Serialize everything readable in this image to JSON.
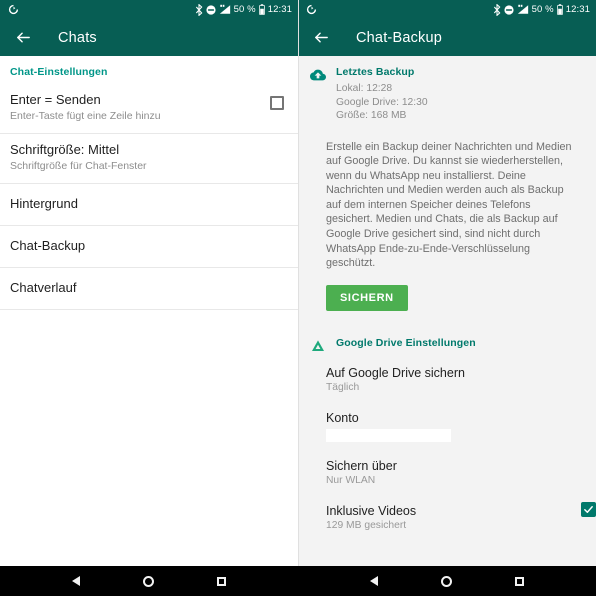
{
  "status_bar": {
    "left_icon": "sync-circle-icon",
    "icons": [
      "bluetooth-icon",
      "do-not-disturb-icon",
      "signal-bars-icon",
      "battery-icon"
    ],
    "battery_percent": "50 %",
    "time": "12:31"
  },
  "left_pane": {
    "appbar": {
      "back_icon": "arrow-back-icon",
      "title": "Chats"
    },
    "section_header": "Chat-Einstellungen",
    "rows": [
      {
        "title": "Enter = Senden",
        "subtitle": "Enter-Taste fügt eine Zeile hinzu",
        "control": "checkbox",
        "checked": false
      },
      {
        "title": "Schriftgröße: Mittel",
        "subtitle": "Schriftgröße für Chat-Fenster",
        "control": "none"
      },
      {
        "title": "Hintergrund",
        "subtitle": "",
        "control": "none"
      },
      {
        "title": "Chat-Backup",
        "subtitle": "",
        "control": "none"
      },
      {
        "title": "Chatverlauf",
        "subtitle": "",
        "control": "none"
      }
    ]
  },
  "right_pane": {
    "appbar": {
      "back_icon": "arrow-back-icon",
      "title": "Chat-Backup"
    },
    "last_backup": {
      "icon": "cloud-upload-icon",
      "header": "Letztes Backup",
      "lines": [
        "Lokal: 12:28",
        "Google Drive: 12:30",
        "Größe: 168 MB"
      ]
    },
    "description": "Erstelle ein Backup deiner Nachrichten und Medien auf Google Drive. Du kannst sie wiederherstellen, wenn du WhatsApp neu installierst. Deine Nachrichten und Medien werden auch als Backup auf dem internen Speicher deines Telefons gesichert. Medien und Chats, die als Backup auf Google Drive gesichert sind, sind nicht durch WhatsApp Ende-zu-Ende-Verschlüsselung geschützt.",
    "backup_button": "SICHERN",
    "google_drive": {
      "icon": "google-drive-icon",
      "header": "Google Drive Einstellungen",
      "options": [
        {
          "title": "Auf Google Drive sichern",
          "subtitle": "Täglich",
          "control": "none"
        },
        {
          "title": "Konto",
          "subtitle": "",
          "control": "redacted-field"
        },
        {
          "title": "Sichern über",
          "subtitle": "Nur WLAN",
          "control": "none"
        },
        {
          "title": "Inklusive Videos",
          "subtitle": "129 MB gesichert",
          "control": "checkbox",
          "checked": true
        }
      ]
    }
  },
  "nav_bar": {
    "buttons": [
      "back-nav-button",
      "home-nav-button",
      "recents-nav-button"
    ]
  },
  "colors": {
    "appbar": "#075E54",
    "accent_teal": "#009688",
    "accent_teal_dark": "#00796B",
    "button_green": "#4CAF50",
    "right_bg": "#f3f3f3"
  }
}
